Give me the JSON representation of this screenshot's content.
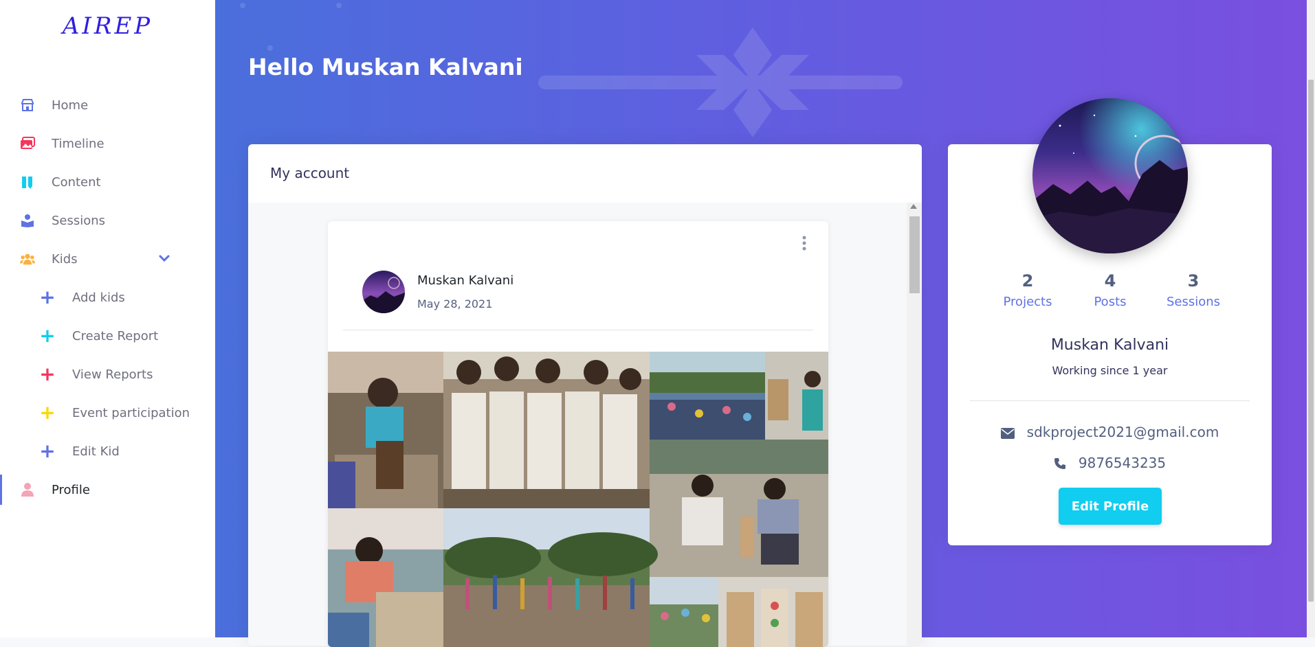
{
  "brand": "AIREP",
  "sidebar": {
    "items": [
      {
        "label": "Home",
        "icon": "shop-icon",
        "color": "#5e72e4"
      },
      {
        "label": "Timeline",
        "icon": "images-icon",
        "color": "#f5365c"
      },
      {
        "label": "Content",
        "icon": "ruler-pencil-icon",
        "color": "#11cdef"
      },
      {
        "label": "Sessions",
        "icon": "book-reader-icon",
        "color": "#5e72e4"
      },
      {
        "label": "Kids",
        "icon": "users-icon",
        "color": "#fbb140"
      },
      {
        "label": "Add kids",
        "icon": "plus-icon",
        "color": "#5e72e4"
      },
      {
        "label": "Create Report",
        "icon": "plus-icon",
        "color": "#11cdef"
      },
      {
        "label": "View Reports",
        "icon": "plus-icon",
        "color": "#f5365c"
      },
      {
        "label": "Event participation",
        "icon": "plus-icon",
        "color": "#ffd600"
      },
      {
        "label": "Edit Kid",
        "icon": "plus-icon",
        "color": "#5e72e4"
      },
      {
        "label": "Profile",
        "icon": "user-icon",
        "color": "#f3a4b5"
      }
    ],
    "active": "Profile"
  },
  "header": {
    "greeting": "Hello Muskan Kalvani"
  },
  "account": {
    "title": "My account",
    "post": {
      "author": "Muskan Kalvani",
      "date": "May 28, 2021"
    }
  },
  "profile": {
    "stats": [
      {
        "value": "2",
        "label": "Projects"
      },
      {
        "value": "4",
        "label": "Posts"
      },
      {
        "value": "3",
        "label": "Sessions"
      }
    ],
    "name": "Muskan Kalvani",
    "since": "Working since 1 year",
    "email": "sdkproject2021@gmail.com",
    "phone": "9876543235",
    "edit_label": "Edit Profile"
  },
  "colors": {
    "accent": "#5e72e4",
    "button": "#11cdef",
    "gradient_start": "#4a6fdc",
    "gradient_end": "#7a4fe0"
  }
}
